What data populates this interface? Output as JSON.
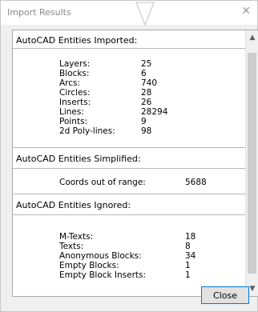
{
  "window": {
    "title": "Import Results",
    "close_glyph": "✕"
  },
  "sections": [
    {
      "heading": "AutoCAD Entities Imported:",
      "rows": [
        {
          "label": "Layers:",
          "value": "25"
        },
        {
          "label": "Blocks:",
          "value": "6"
        },
        {
          "label": "Arcs:",
          "value": "740"
        },
        {
          "label": "Circles:",
          "value": "28"
        },
        {
          "label": "Inserts:",
          "value": "26"
        },
        {
          "label": "Lines:",
          "value": "28294"
        },
        {
          "label": "Points:",
          "value": "9"
        },
        {
          "label": "2d Poly-lines:",
          "value": "98"
        }
      ]
    },
    {
      "heading": "AutoCAD Entities Simplified:",
      "rows": [
        {
          "label": "Coords out of range:",
          "value": "5688"
        }
      ]
    },
    {
      "heading": "AutoCAD Entities Ignored:",
      "rows": [
        {
          "label": "M-Texts:",
          "value": "18"
        },
        {
          "label": "Texts:",
          "value": "8"
        },
        {
          "label": "Anonymous Blocks:",
          "value": "34"
        },
        {
          "label": "Empty Blocks:",
          "value": "1"
        },
        {
          "label": "Empty Block Inserts:",
          "value": "1"
        }
      ]
    }
  ],
  "buttons": {
    "close_label": "Close"
  },
  "icons": {
    "scroll_up": "chevron-up-icon",
    "scroll_down": "chevron-down-icon",
    "cursor": "mouse-pointer-icon"
  }
}
